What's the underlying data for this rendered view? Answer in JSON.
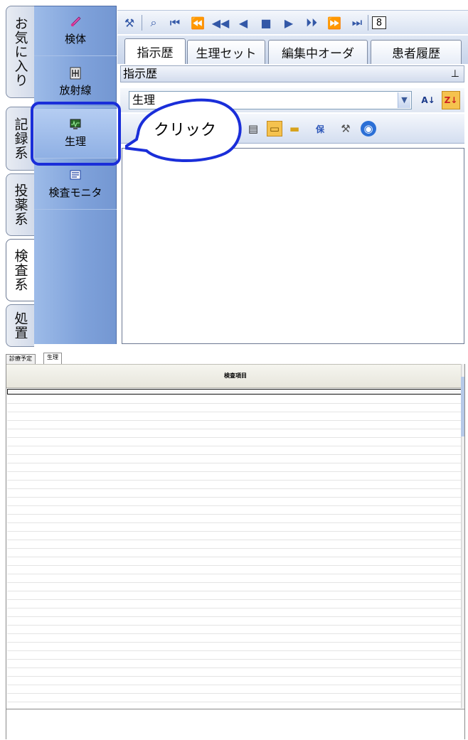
{
  "vertical_tabs": [
    {
      "label": "お気に入り",
      "active": false
    },
    {
      "label": "記録系",
      "active": false
    },
    {
      "label": "投薬系",
      "active": false
    },
    {
      "label": "検査系",
      "active": true
    },
    {
      "label": "処置",
      "active": false
    }
  ],
  "nav_items": [
    {
      "label": "検体",
      "icon": "test-tube-icon"
    },
    {
      "label": "放射線",
      "icon": "radiation-icon"
    },
    {
      "label": "生理",
      "icon": "monitor-icon"
    },
    {
      "label": "検査モニタ",
      "icon": "monitor-list-icon"
    }
  ],
  "toolbar_top": {
    "page_number": "8"
  },
  "tabs": [
    {
      "label": "指示歴",
      "active": true
    },
    {
      "label": "生理セット",
      "active": false
    },
    {
      "label": "編集中オーダ",
      "active": false
    },
    {
      "label": "患者履歴",
      "active": false
    }
  ],
  "panel_title": "指示歴",
  "pin_icon": "pin-icon",
  "combo": {
    "value": "生理"
  },
  "callout": {
    "text": "クリック"
  },
  "accent_color": "#1a2ed9",
  "bottom": {
    "tabs": [
      {
        "label": "診療予定",
        "active": false
      },
      {
        "label": "生理",
        "active": true
      }
    ],
    "column_header": "検査項目"
  }
}
